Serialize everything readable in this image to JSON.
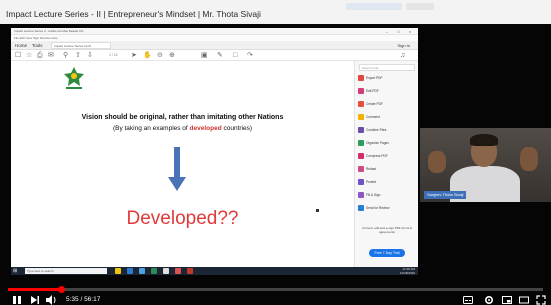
{
  "header": {
    "video_title": "Impact Lecture Series - II | Entrepreneur's Mindset | Mr. Thota Sivaji"
  },
  "screen": {
    "window": {
      "title": "Impact Lecture Series II - Adobe Acrobat Reader DC",
      "menu": "File  Edit  View  Sign  Window  Help",
      "tabs": [
        "Home",
        "Tools"
      ],
      "doc_tab": "Impact Lecture Series II.pdf",
      "sign_in": "Sign In",
      "page_indicator": "1 / 12"
    },
    "slide": {
      "title": "Vision should be original, rather than imitating other Nations",
      "sub_prefix": "(By taking an examples of ",
      "sub_accent": "developed",
      "sub_suffix": " countries)",
      "big_word": "Developed??"
    },
    "panel": {
      "search_placeholder": "Search tools",
      "items": [
        {
          "label": "Export PDF",
          "color": "#e0483d"
        },
        {
          "label": "Edit PDF",
          "color": "#d43c7a"
        },
        {
          "label": "Create PDF",
          "color": "#e4513f"
        },
        {
          "label": "Comment",
          "color": "#f0b400"
        },
        {
          "label": "Combine Files",
          "color": "#6b4ea6"
        },
        {
          "label": "Organize Pages",
          "color": "#2d9d5d"
        },
        {
          "label": "Compress PDF",
          "color": "#d62c6b"
        },
        {
          "label": "Redact",
          "color": "#d04b83"
        },
        {
          "label": "Protect",
          "color": "#6e53c5"
        },
        {
          "label": "Fill & Sign",
          "color": "#8d59c0"
        },
        {
          "label": "Send for Review",
          "color": "#2e7bd6"
        }
      ],
      "promo": "Convert, edit and e-sign PDF forms & agreements",
      "promo_button": "Free 7-Day Trial"
    },
    "taskbar": {
      "search_placeholder": "Type here to search",
      "clock_time": "11:58 AM",
      "clock_date": "10/28/2020"
    }
  },
  "webcam": {
    "name_label": "Sanjeev Thota Sivaji"
  },
  "player": {
    "current_time": "5:35",
    "duration": "56:17",
    "time_display": "5:35 / 56:17",
    "progress_fraction": 0.099
  },
  "icons": {
    "play_pause": "pause-icon",
    "next": "next-icon",
    "volume": "volume-icon",
    "subtitles": "subtitles-icon",
    "settings": "gear-icon",
    "miniplayer": "miniplayer-icon",
    "theater": "theater-icon",
    "fullscreen": "fullscreen-icon"
  },
  "colors": {
    "progress": "#ff0000",
    "slide_accent": "#d0312d",
    "big_word": "#e03a3a",
    "arrow": "#4a72b6",
    "cam_label": "#3d6fb8"
  }
}
